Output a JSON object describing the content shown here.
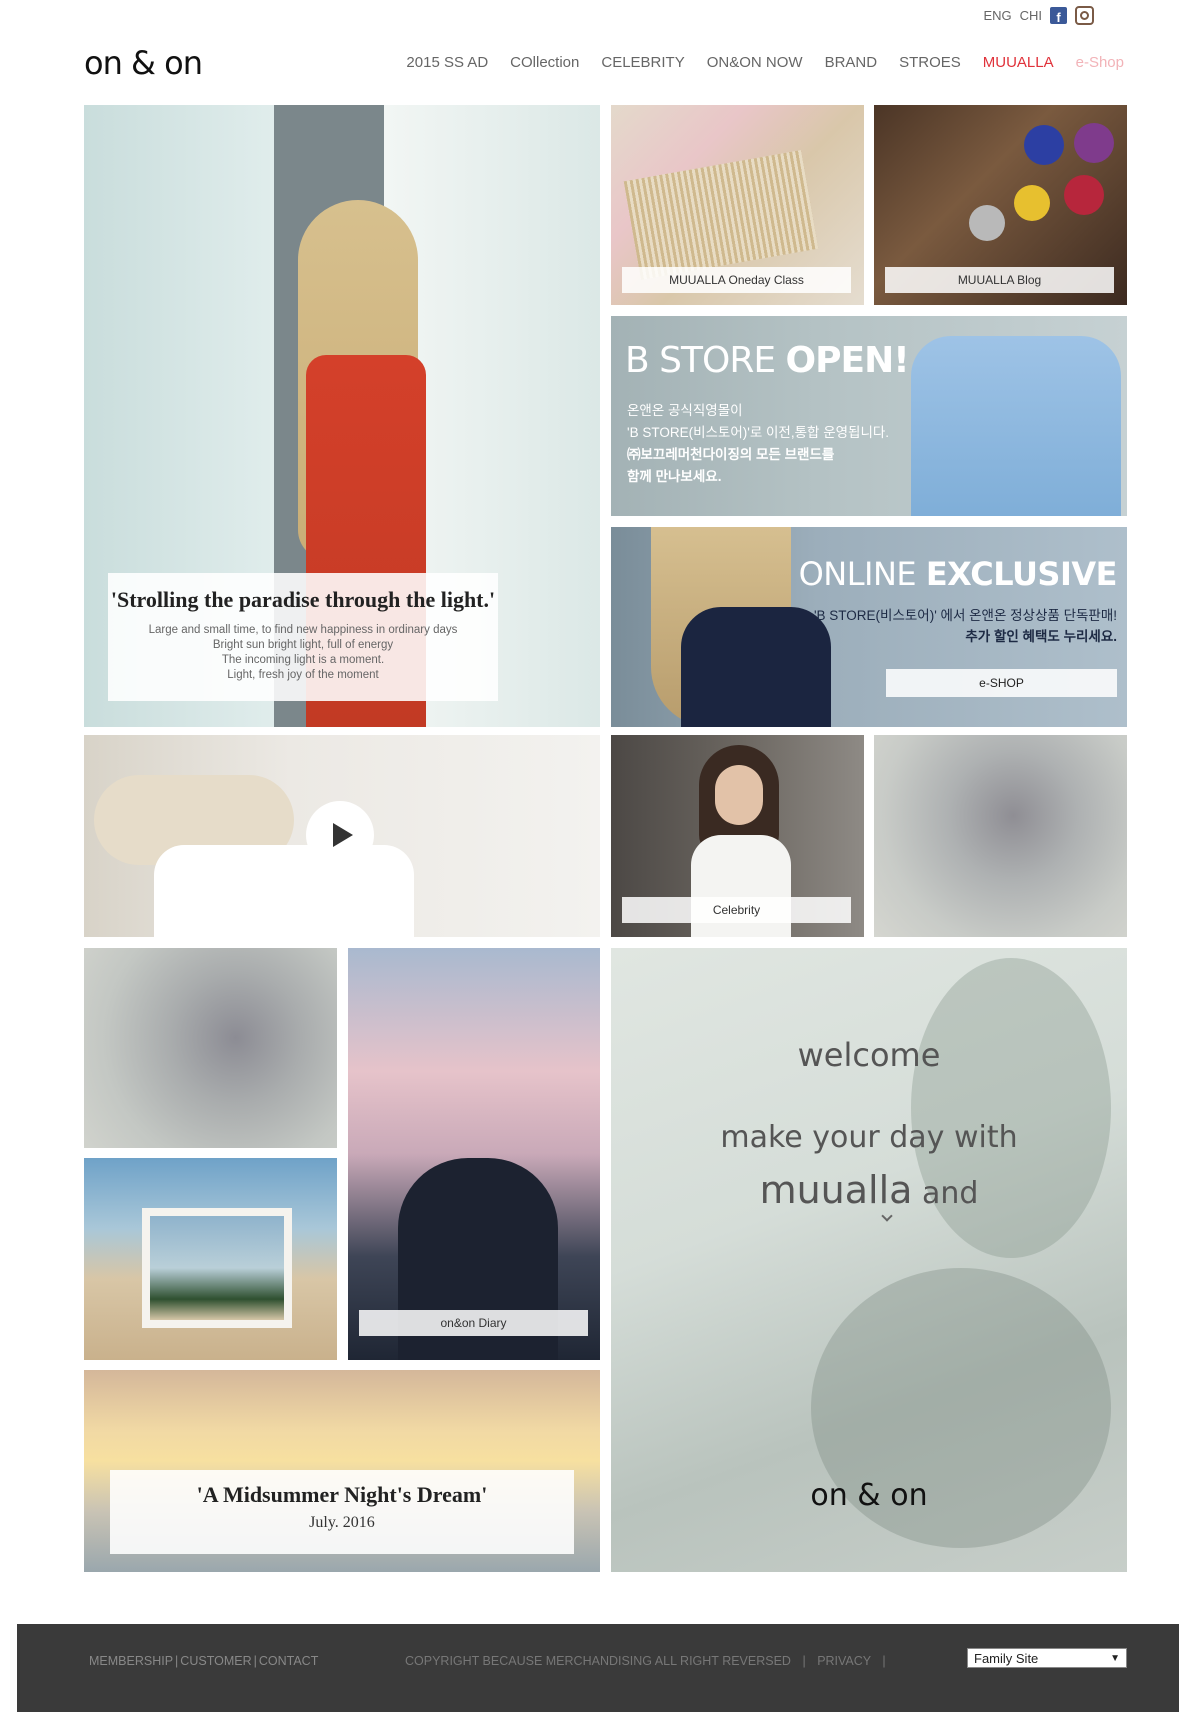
{
  "topbar": {
    "eng": "ENG",
    "chi": "CHI"
  },
  "logo": {
    "text": "on & on"
  },
  "nav": {
    "items": [
      {
        "label": "2015 SS AD",
        "color": "#666666"
      },
      {
        "label": "COllection",
        "color": "#666666"
      },
      {
        "label": "CELEBRITY",
        "color": "#666666"
      },
      {
        "label": "ON&ON NOW",
        "color": "#666666"
      },
      {
        "label": "BRAND",
        "color": "#666666"
      },
      {
        "label": "STROES",
        "color": "#666666"
      },
      {
        "label": "MUUALLA",
        "color": "#e0323a"
      },
      {
        "label": "e-Shop",
        "color": "#f2b3b8"
      }
    ]
  },
  "hero": {
    "title": "'Strolling the paradise through the light.'",
    "lines": [
      "Large and small time, to find new happiness in ordinary days",
      "Bright sun bright light, full of energy",
      "The incoming light is a moment.",
      "Light, fresh joy of the moment"
    ]
  },
  "muualla_class": {
    "caption": "MUUALLA Oneday Class"
  },
  "muualla_blog": {
    "caption": "MUUALLA Blog"
  },
  "bstore": {
    "title_a": "B STORE ",
    "title_b": "OPEN!",
    "lines": [
      "온앤온 공식직영몰이",
      "'B STORE(비스토어)'로 이전,통합 운영됩니다.",
      "㈜보끄레머천다이징의 모든 브랜드를",
      "함께 만나보세요."
    ]
  },
  "online": {
    "title_a": "ONLINE ",
    "title_b": "EXCLUSIVE",
    "line1": "'B STORE(비스토어)' 에서 온앤온 정상상품 단독판매!",
    "line2": "추가 할인 혜택도 누리세요.",
    "button": "e-SHOP"
  },
  "celebrity": {
    "caption": "Celebrity"
  },
  "diary": {
    "caption": "on&on Diary"
  },
  "midsummer": {
    "title": "'A Midsummer Night's Dream'",
    "date": "July. 2016"
  },
  "welcome": {
    "line1": "welcome",
    "line2": "make your day with",
    "line3a": "muualla",
    "line3b": " and",
    "logo": "on & on"
  },
  "footer": {
    "membership": "MEMBERSHIP",
    "customer": "CUSTOMER",
    "contact": "CONTACT",
    "copyright": "COPYRIGHT BECAUSE MERCHANDISING ALL RIGHT REVERSED",
    "privacy": "PRIVACY",
    "family_site": "Family Site"
  }
}
